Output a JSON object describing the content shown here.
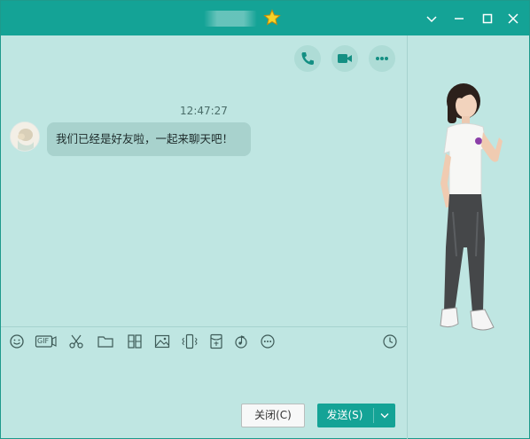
{
  "window": {
    "contact_name": "",
    "controls": [
      "minimize",
      "maximize",
      "close"
    ],
    "dropdown": "chevron-down"
  },
  "header_actions": [
    {
      "name": "voice-call",
      "icon": "phone-icon"
    },
    {
      "name": "video-call",
      "icon": "video-camera-icon"
    },
    {
      "name": "more",
      "icon": "more-dots-icon"
    }
  ],
  "chat": {
    "timestamp": "12:47:27",
    "messages": [
      {
        "from": "contact",
        "text": "我们已经是好友啦，一起来聊天吧！"
      }
    ]
  },
  "toolbar": {
    "items": [
      "emoji-icon",
      "gif-icon",
      "scissors-icon",
      "folder-icon",
      "image-grid-icon",
      "picture-icon",
      "shake-icon",
      "red-packet-icon",
      "music-icon",
      "more-icon"
    ],
    "gif_label": "GIF",
    "history": "clock-icon"
  },
  "footer": {
    "close_label": "关闭(C)",
    "send_label": "发送(S)"
  },
  "colors": {
    "accent": "#14a396",
    "background": "#bfe6e2",
    "bubble": "#a8d2cd"
  }
}
